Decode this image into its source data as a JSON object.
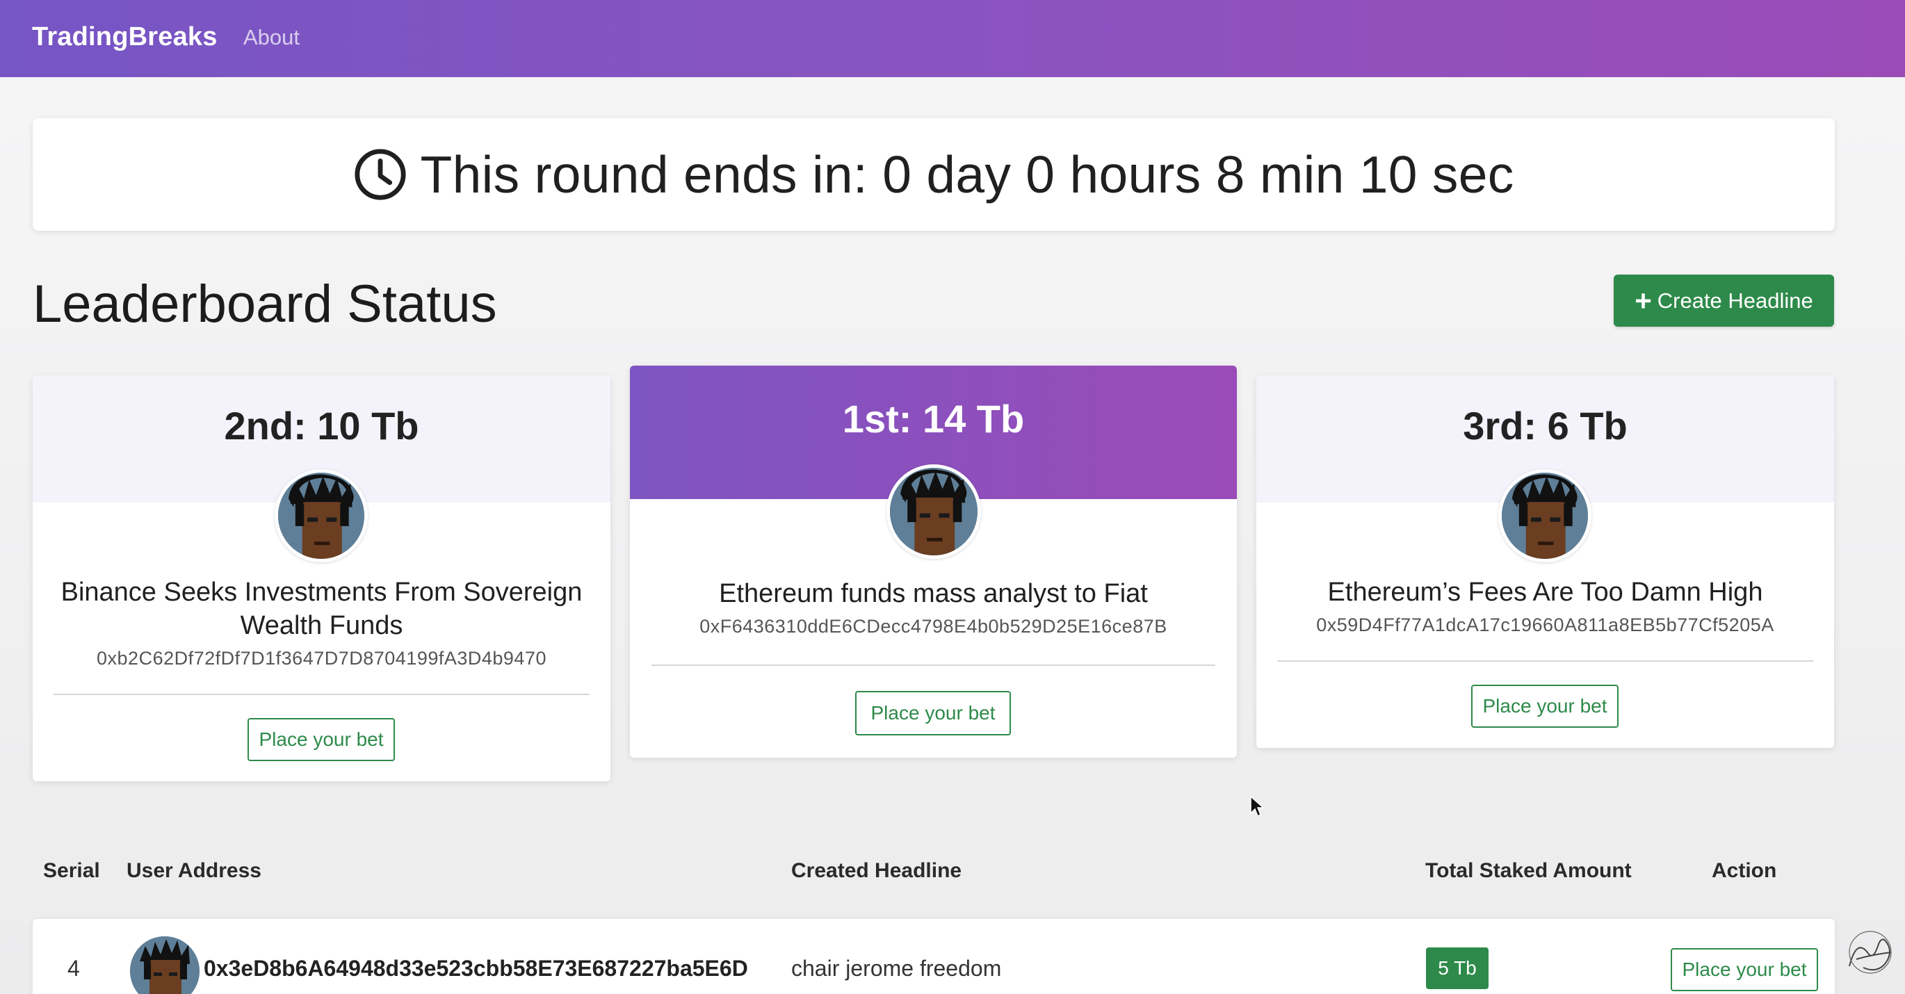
{
  "navbar": {
    "brand": "TradingBreaks",
    "links": [
      "About"
    ]
  },
  "countdown": {
    "icon": "clock-icon",
    "text": "This round ends in: 0 day 0 hours 8 min 10 sec"
  },
  "leaderboard": {
    "title": "Leaderboard Status",
    "create_button": "Create Headline",
    "create_icon": "plus-icon",
    "cards": [
      {
        "rank": "2nd: 10 Tb",
        "headline": "Binance Seeks Investments From Sovereign Wealth Funds",
        "address": "0xb2C62Df72fDf7D1f3647D7D8704199fA3D4b9470",
        "button": "Place your bet"
      },
      {
        "rank": "1st: 14 Tb",
        "headline": "Ethereum funds mass analyst to Fiat",
        "address": "0xF6436310ddE6CDecc4798E4b0b529D25E16ce87B",
        "button": "Place your bet"
      },
      {
        "rank": "3rd: 6 Tb",
        "headline": "Ethereum’s Fees Are Too Damn High",
        "address": "0x59D4Ff77A1dcA17c19660A811a8EB5b77Cf5205A",
        "button": "Place your bet"
      }
    ]
  },
  "table": {
    "headers": [
      "Serial",
      "User Address",
      "Created Headline",
      "Total Staked Amount",
      "Action"
    ],
    "rows": [
      {
        "serial": "4",
        "address": "0x3eD8b6A64948d33e523cbb58E73E687227ba5E6D",
        "headline": "chair jerome freedom",
        "amount": "5 Tb",
        "action": "Place your bet"
      }
    ]
  },
  "colors": {
    "nav_gradient_start": "#7655c4",
    "nav_gradient_end": "#9a4bb8",
    "accent_green": "#2e8a4a",
    "first_place_header": "#8a54c0"
  }
}
